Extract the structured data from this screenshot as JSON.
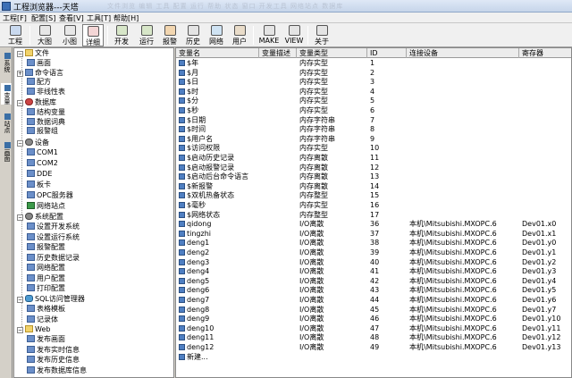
{
  "window": {
    "title": "工程浏览器---天塔",
    "faded_strip": "文件浏览 编辑 工具 配置 运行 帮助 状态 窗口 开发工具 网络站点 数据库"
  },
  "menu": [
    {
      "label": "工程[F]"
    },
    {
      "label": "配置[S]"
    },
    {
      "label": "查看[V]"
    },
    {
      "label": "工具[T]"
    },
    {
      "label": "帮助[H]"
    }
  ],
  "toolbar": [
    {
      "label": "工程",
      "icon": "project-icon"
    },
    {
      "label": "大图",
      "icon": "large-icons-icon"
    },
    {
      "label": "小图",
      "icon": "small-icons-icon"
    },
    {
      "label": "详细",
      "icon": "details-icon"
    },
    {
      "label": "开发",
      "icon": "develop-icon"
    },
    {
      "label": "运行",
      "icon": "run-icon"
    },
    {
      "label": "报警",
      "icon": "alarm-icon"
    },
    {
      "label": "历史",
      "icon": "history-icon"
    },
    {
      "label": "网络",
      "icon": "network-icon"
    },
    {
      "label": "用户",
      "icon": "user-icon"
    },
    {
      "label": "MAKE",
      "icon": "make-icon"
    },
    {
      "label": "VIEW",
      "icon": "view-icon"
    },
    {
      "label": "关于",
      "icon": "about-icon"
    }
  ],
  "vtabs": [
    {
      "label": "系统"
    },
    {
      "label": "变量"
    },
    {
      "label": "站点"
    },
    {
      "label": "画面"
    }
  ],
  "tree": [
    {
      "label": "文件",
      "icon": "folder"
    },
    {
      "label": "画面",
      "icon": "item"
    },
    {
      "label": "命令语言",
      "icon": "item"
    },
    {
      "label": "配方",
      "icon": "item"
    },
    {
      "label": "非线性表",
      "icon": "item"
    },
    {
      "label": "数据库",
      "icon": "db"
    },
    {
      "label": "结构变量",
      "icon": "item"
    },
    {
      "label": "数据词典",
      "icon": "item"
    },
    {
      "label": "报警组",
      "icon": "item"
    },
    {
      "label": "设备",
      "icon": "gear"
    },
    {
      "label": "COM1",
      "icon": "item"
    },
    {
      "label": "COM2",
      "icon": "item"
    },
    {
      "label": "DDE",
      "icon": "item"
    },
    {
      "label": "板卡",
      "icon": "item"
    },
    {
      "label": "OPC服务器",
      "icon": "item"
    },
    {
      "label": "网络站点",
      "icon": "net"
    },
    {
      "label": "系统配置",
      "icon": "gear"
    },
    {
      "label": "设置开发系统",
      "icon": "item"
    },
    {
      "label": "设置运行系统",
      "icon": "item"
    },
    {
      "label": "报警配置",
      "icon": "item"
    },
    {
      "label": "历史数据记录",
      "icon": "item"
    },
    {
      "label": "网络配置",
      "icon": "item"
    },
    {
      "label": "用户配置",
      "icon": "item"
    },
    {
      "label": "打印配置",
      "icon": "item"
    },
    {
      "label": "SQL访问管理器",
      "icon": "sql"
    },
    {
      "label": "表格模板",
      "icon": "item"
    },
    {
      "label": "记录体",
      "icon": "item"
    },
    {
      "label": "Web",
      "icon": "folder"
    },
    {
      "label": "发布画面",
      "icon": "item"
    },
    {
      "label": "发布实时信息",
      "icon": "item"
    },
    {
      "label": "发布历史信息",
      "icon": "item"
    },
    {
      "label": "发布数据库信息",
      "icon": "item"
    }
  ],
  "table": {
    "headers": [
      "变量名",
      "变量描述",
      "变量类型",
      "ID",
      "连接设备",
      "寄存器"
    ],
    "rows": [
      [
        "$年",
        "",
        "内存实型",
        "1",
        "",
        ""
      ],
      [
        "$月",
        "",
        "内存实型",
        "2",
        "",
        ""
      ],
      [
        "$日",
        "",
        "内存实型",
        "3",
        "",
        ""
      ],
      [
        "$时",
        "",
        "内存实型",
        "4",
        "",
        ""
      ],
      [
        "$分",
        "",
        "内存实型",
        "5",
        "",
        ""
      ],
      [
        "$秒",
        "",
        "内存实型",
        "6",
        "",
        ""
      ],
      [
        "$日期",
        "",
        "内存字符串",
        "7",
        "",
        ""
      ],
      [
        "$时间",
        "",
        "内存字符串",
        "8",
        "",
        ""
      ],
      [
        "$用户名",
        "",
        "内存字符串",
        "9",
        "",
        ""
      ],
      [
        "$访问权限",
        "",
        "内存实型",
        "10",
        "",
        ""
      ],
      [
        "$启动历史记录",
        "",
        "内存离散",
        "11",
        "",
        ""
      ],
      [
        "$启动报警记录",
        "",
        "内存离散",
        "12",
        "",
        ""
      ],
      [
        "$启动后台命令语言",
        "",
        "内存离散",
        "13",
        "",
        ""
      ],
      [
        "$新报警",
        "",
        "内存离散",
        "14",
        "",
        ""
      ],
      [
        "$双机热备状态",
        "",
        "内存整型",
        "15",
        "",
        ""
      ],
      [
        "$毫秒",
        "",
        "内存实型",
        "16",
        "",
        ""
      ],
      [
        "$网络状态",
        "",
        "内存整型",
        "17",
        "",
        ""
      ],
      [
        "qidong",
        "",
        "I/O离散",
        "36",
        "本机\\Mitsubishi.MXOPC.6",
        "Dev01.x0"
      ],
      [
        "tingzhi",
        "",
        "I/O离散",
        "37",
        "本机\\Mitsubishi.MXOPC.6",
        "Dev01.x1"
      ],
      [
        "deng1",
        "",
        "I/O离散",
        "38",
        "本机\\Mitsubishi.MXOPC.6",
        "Dev01.y0"
      ],
      [
        "deng2",
        "",
        "I/O离散",
        "39",
        "本机\\Mitsubishi.MXOPC.6",
        "Dev01.y1"
      ],
      [
        "deng3",
        "",
        "I/O离散",
        "40",
        "本机\\Mitsubishi.MXOPC.6",
        "Dev01.y2"
      ],
      [
        "deng4",
        "",
        "I/O离散",
        "41",
        "本机\\Mitsubishi.MXOPC.6",
        "Dev01.y3"
      ],
      [
        "deng5",
        "",
        "I/O离散",
        "42",
        "本机\\Mitsubishi.MXOPC.6",
        "Dev01.y4"
      ],
      [
        "deng6",
        "",
        "I/O离散",
        "43",
        "本机\\Mitsubishi.MXOPC.6",
        "Dev01.y5"
      ],
      [
        "deng7",
        "",
        "I/O离散",
        "44",
        "本机\\Mitsubishi.MXOPC.6",
        "Dev01.y6"
      ],
      [
        "deng8",
        "",
        "I/O离散",
        "45",
        "本机\\Mitsubishi.MXOPC.6",
        "Dev01.y7"
      ],
      [
        "deng9",
        "",
        "I/O离散",
        "46",
        "本机\\Mitsubishi.MXOPC.6",
        "Dev01.y10"
      ],
      [
        "deng10",
        "",
        "I/O离散",
        "47",
        "本机\\Mitsubishi.MXOPC.6",
        "Dev01.y11"
      ],
      [
        "deng11",
        "",
        "I/O离散",
        "48",
        "本机\\Mitsubishi.MXOPC.6",
        "Dev01.y12"
      ],
      [
        "deng12",
        "",
        "I/O离散",
        "49",
        "本机\\Mitsubishi.MXOPC.6",
        "Dev01.y13"
      ],
      [
        "新建...",
        "",
        "",
        "",
        "",
        ""
      ]
    ]
  }
}
